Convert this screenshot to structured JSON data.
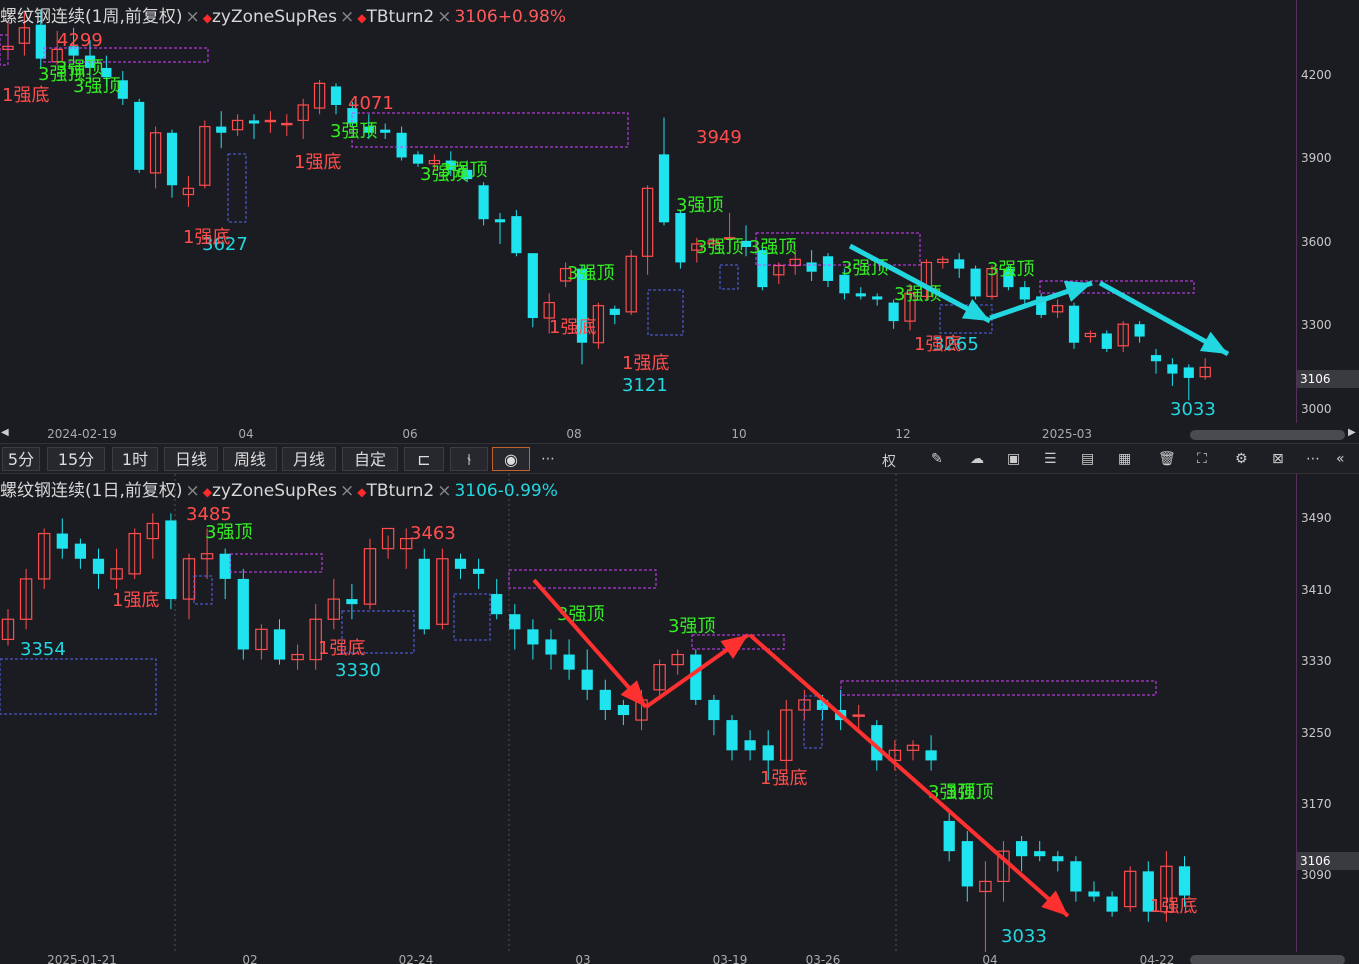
{
  "top": {
    "title": {
      "name": "螺纹钢连续(1周,前复权)",
      "ind1": "zyZoneSupRes",
      "ind2": "TBturn2",
      "change": "3106+0.98%"
    },
    "y_ticks": [
      "4200",
      "3900",
      "3600",
      "3300",
      "3000"
    ],
    "y_current": "3106",
    "x_ticks": [
      "2024-02-19",
      "04",
      "06",
      "08",
      "10",
      "12",
      "2025-03"
    ]
  },
  "bottom": {
    "title": {
      "name": "螺纹钢连续(1日,前复权)",
      "ind1": "zyZoneSupRes",
      "ind2": "TBturn2",
      "change": "3106-0.99%"
    },
    "y_ticks": [
      "3490",
      "3410",
      "3330",
      "3250",
      "3170",
      "3090"
    ],
    "y_current": "3106",
    "x_ticks": [
      "2025-01-21",
      "02",
      "02-24",
      "03",
      "03-19",
      "03-26",
      "04",
      "04-22"
    ]
  },
  "toolbar": {
    "periods": [
      "5分",
      "15分",
      "1时",
      "日线",
      "周线",
      "月线",
      "自定"
    ],
    "tool_icons": [
      "candle-style-icon",
      "indicator-icon",
      "eye-icon",
      "more-icon"
    ],
    "right_icons": [
      "fuquan-label",
      "draw-icon",
      "cloud-icon",
      "image-icon",
      "settings-slider-icon",
      "calculator-icon",
      "layout-icon",
      "delete-icon",
      "fullscreen-icon",
      "gear-icon",
      "zoom-icon",
      "more-icon",
      "collapse-icon"
    ],
    "fuquan_label": "权"
  },
  "chart_data": [
    {
      "type": "candlestick",
      "title": "螺纹钢连续(1周,前复权)",
      "ylim": [
        2960,
        4330
      ],
      "y_ticks": [
        4200,
        3900,
        3600,
        3300,
        3000
      ],
      "up_color": "#ff4d4d",
      "down_color": "#1fe3ee",
      "candles": [
        [
          4170,
          4180,
          4260,
          4140
        ],
        [
          4190,
          4240,
          4290,
          4150
        ],
        [
          4250,
          4140,
          4299,
          4110
        ],
        [
          4130,
          4170,
          4230,
          4120
        ],
        [
          4180,
          4150,
          4240,
          4130
        ],
        [
          4150,
          4110,
          4200,
          4060
        ],
        [
          4110,
          4080,
          4150,
          4050
        ],
        [
          4070,
          4010,
          4100,
          3990
        ],
        [
          4000,
          3780,
          4010,
          3770
        ],
        [
          3770,
          3900,
          3920,
          3720
        ],
        [
          3900,
          3730,
          3910,
          3690
        ],
        [
          3700,
          3720,
          3760,
          3660
        ],
        [
          3730,
          3920,
          3940,
          3720
        ],
        [
          3920,
          3900,
          3970,
          3850
        ],
        [
          3910,
          3940,
          3960,
          3890
        ],
        [
          3940,
          3930,
          3960,
          3880
        ],
        [
          3940,
          3940,
          3970,
          3900
        ],
        [
          3930,
          3930,
          3960,
          3890
        ],
        [
          3940,
          3990,
          4010,
          3880
        ],
        [
          3980,
          4060,
          4071,
          3960
        ],
        [
          4050,
          3990,
          4060,
          3960
        ],
        [
          3980,
          3930,
          4000,
          3920
        ],
        [
          3920,
          3900,
          3960,
          3880
        ],
        [
          3910,
          3900,
          3930,
          3880
        ],
        [
          3900,
          3820,
          3920,
          3810
        ],
        [
          3830,
          3800,
          3840,
          3790
        ],
        [
          3800,
          3810,
          3830,
          3780
        ],
        [
          3810,
          3780,
          3840,
          3760
        ],
        [
          3780,
          3750,
          3810,
          3740
        ],
        [
          3730,
          3620,
          3740,
          3600
        ],
        [
          3620,
          3610,
          3640,
          3540
        ],
        [
          3630,
          3510,
          3650,
          3500
        ],
        [
          3510,
          3300,
          3510,
          3270
        ],
        [
          3300,
          3350,
          3380,
          3250
        ],
        [
          3420,
          3460,
          3480,
          3400
        ],
        [
          3460,
          3220,
          3470,
          3150
        ],
        [
          3220,
          3340,
          3350,
          3200
        ],
        [
          3330,
          3310,
          3340,
          3280
        ],
        [
          3320,
          3500,
          3520,
          3310
        ],
        [
          3500,
          3720,
          3730,
          3440
        ],
        [
          3830,
          3610,
          3949,
          3600
        ],
        [
          3640,
          3480,
          3650,
          3460
        ],
        [
          3520,
          3540,
          3560,
          3480
        ],
        [
          3540,
          3550,
          3560,
          3510
        ],
        [
          3560,
          3560,
          3640,
          3530
        ],
        [
          3550,
          3530,
          3600,
          3500
        ],
        [
          3520,
          3400,
          3540,
          3390
        ],
        [
          3440,
          3470,
          3480,
          3410
        ],
        [
          3470,
          3490,
          3520,
          3440
        ],
        [
          3480,
          3450,
          3520,
          3420
        ],
        [
          3500,
          3420,
          3510,
          3400
        ],
        [
          3440,
          3380,
          3460,
          3360
        ],
        [
          3380,
          3370,
          3400,
          3360
        ],
        [
          3370,
          3360,
          3380,
          3340
        ],
        [
          3350,
          3290,
          3360,
          3265
        ],
        [
          3290,
          3380,
          3410,
          3260
        ],
        [
          3370,
          3480,
          3490,
          3360
        ],
        [
          3480,
          3490,
          3500,
          3460
        ],
        [
          3490,
          3460,
          3510,
          3430
        ],
        [
          3460,
          3370,
          3470,
          3360
        ],
        [
          3370,
          3460,
          3470,
          3360
        ],
        [
          3460,
          3400,
          3470,
          3390
        ],
        [
          3400,
          3360,
          3420,
          3340
        ],
        [
          3370,
          3310,
          3380,
          3300
        ],
        [
          3320,
          3340,
          3360,
          3300
        ],
        [
          3340,
          3220,
          3350,
          3200
        ],
        [
          3240,
          3250,
          3260,
          3220
        ],
        [
          3250,
          3200,
          3260,
          3190
        ],
        [
          3210,
          3280,
          3290,
          3190
        ],
        [
          3280,
          3240,
          3290,
          3220
        ],
        [
          3180,
          3160,
          3200,
          3120
        ],
        [
          3150,
          3120,
          3170,
          3080
        ],
        [
          3140,
          3106,
          3150,
          3033
        ],
        [
          3110,
          3140,
          3170,
          3100
        ]
      ],
      "annotations": [
        {
          "text": "4299",
          "kind": "high"
        },
        {
          "text": "4071",
          "kind": "high"
        },
        {
          "text": "3949",
          "kind": "high"
        },
        {
          "text": "3627",
          "kind": "low"
        },
        {
          "text": "3121",
          "kind": "low"
        },
        {
          "text": "3265",
          "kind": "low"
        },
        {
          "text": "3033",
          "kind": "low"
        },
        {
          "text": "3强顶",
          "kind": "top"
        },
        {
          "text": "1强底",
          "kind": "bottom"
        }
      ]
    },
    {
      "type": "candlestick",
      "title": "螺纹钢连续(1日,前复权)",
      "ylim": [
        3050,
        3530
      ],
      "y_ticks": [
        3490,
        3410,
        3330,
        3250,
        3170,
        3090
      ],
      "up_color": "#ff4d4d",
      "down_color": "#1fe3ee",
      "candles": [
        [
          3360,
          3380,
          3390,
          3354
        ],
        [
          3380,
          3420,
          3430,
          3370
        ],
        [
          3420,
          3465,
          3470,
          3410
        ],
        [
          3465,
          3450,
          3480,
          3440
        ],
        [
          3455,
          3440,
          3460,
          3430
        ],
        [
          3440,
          3425,
          3450,
          3410
        ],
        [
          3420,
          3430,
          3450,
          3410
        ],
        [
          3425,
          3465,
          3470,
          3420
        ],
        [
          3460,
          3475,
          3485,
          3440
        ],
        [
          3478,
          3400,
          3485,
          3390
        ],
        [
          3400,
          3440,
          3445,
          3380
        ],
        [
          3440,
          3445,
          3470,
          3420
        ],
        [
          3445,
          3420,
          3450,
          3400
        ],
        [
          3420,
          3350,
          3430,
          3340
        ],
        [
          3350,
          3370,
          3375,
          3340
        ],
        [
          3370,
          3340,
          3380,
          3335
        ],
        [
          3340,
          3345,
          3355,
          3330
        ],
        [
          3340,
          3380,
          3395,
          3330
        ],
        [
          3380,
          3400,
          3420,
          3370
        ],
        [
          3400,
          3395,
          3415,
          3380
        ],
        [
          3395,
          3450,
          3460,
          3390
        ],
        [
          3450,
          3470,
          3463,
          3440
        ],
        [
          3450,
          3460,
          3470,
          3430
        ],
        [
          3440,
          3370,
          3450,
          3365
        ],
        [
          3375,
          3440,
          3450,
          3370
        ],
        [
          3440,
          3430,
          3445,
          3420
        ],
        [
          3430,
          3425,
          3440,
          3410
        ],
        [
          3405,
          3385,
          3420,
          3380
        ],
        [
          3385,
          3370,
          3395,
          3350
        ],
        [
          3370,
          3355,
          3380,
          3340
        ],
        [
          3360,
          3345,
          3370,
          3330
        ],
        [
          3345,
          3330,
          3360,
          3320
        ],
        [
          3330,
          3310,
          3350,
          3300
        ],
        [
          3310,
          3290,
          3320,
          3280
        ],
        [
          3295,
          3285,
          3300,
          3275
        ],
        [
          3280,
          3300,
          3310,
          3270
        ],
        [
          3310,
          3335,
          3340,
          3300
        ],
        [
          3335,
          3345,
          3350,
          3325
        ],
        [
          3345,
          3300,
          3350,
          3295
        ],
        [
          3300,
          3280,
          3305,
          3265
        ],
        [
          3280,
          3250,
          3285,
          3240
        ],
        [
          3260,
          3250,
          3270,
          3240
        ],
        [
          3255,
          3240,
          3270,
          3220
        ],
        [
          3240,
          3290,
          3300,
          3230
        ],
        [
          3290,
          3300,
          3310,
          3280
        ],
        [
          3300,
          3290,
          3305,
          3280
        ],
        [
          3290,
          3280,
          3310,
          3270
        ],
        [
          3285,
          3285,
          3295,
          3270
        ],
        [
          3275,
          3240,
          3280,
          3230
        ],
        [
          3240,
          3250,
          3260,
          3230
        ],
        [
          3250,
          3255,
          3260,
          3240
        ],
        [
          3250,
          3240,
          3265,
          3230
        ],
        [
          3180,
          3150,
          3190,
          3140
        ],
        [
          3160,
          3115,
          3170,
          3100
        ],
        [
          3110,
          3120,
          3140,
          3033
        ],
        [
          3120,
          3150,
          3160,
          3100
        ],
        [
          3160,
          3145,
          3165,
          3130
        ],
        [
          3150,
          3145,
          3160,
          3140
        ],
        [
          3145,
          3140,
          3150,
          3130
        ],
        [
          3140,
          3110,
          3145,
          3100
        ],
        [
          3110,
          3105,
          3120,
          3100
        ],
        [
          3105,
          3090,
          3110,
          3085
        ],
        [
          3095,
          3130,
          3135,
          3090
        ],
        [
          3130,
          3090,
          3140,
          3080
        ],
        [
          3090,
          3135,
          3150,
          3080
        ],
        [
          3135,
          3106,
          3145,
          3095
        ]
      ],
      "annotations": [
        {
          "text": "3485",
          "kind": "high"
        },
        {
          "text": "3463",
          "kind": "high"
        },
        {
          "text": "3354",
          "kind": "low"
        },
        {
          "text": "3330",
          "kind": "low"
        },
        {
          "text": "3033",
          "kind": "low"
        },
        {
          "text": "3强顶",
          "kind": "top"
        },
        {
          "text": "1强底",
          "kind": "bottom"
        }
      ]
    }
  ],
  "labels": {
    "top_highs": [
      "4299",
      "4071",
      "3949"
    ],
    "top_lows": [
      "3627",
      "3121",
      "3265",
      "3033"
    ],
    "bot_highs": [
      "3485",
      "3463"
    ],
    "bot_lows": [
      "3354",
      "3330",
      "3033"
    ],
    "strong_top": "3强顶",
    "strong_bottom": "1强底"
  }
}
